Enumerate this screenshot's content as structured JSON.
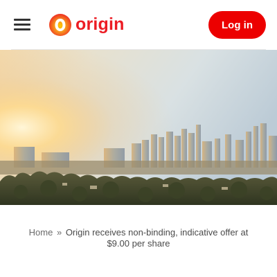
{
  "header": {
    "logo_text": "origin",
    "login_label": "Log in",
    "brand_color": "#ec1c24",
    "menu_icon": "hamburger-menu-icon"
  },
  "hero": {
    "description_icon": "city-skyline-sunrise-image"
  },
  "breadcrumb": {
    "home_label": "Home",
    "separator": "»",
    "current": "Origin receives non-binding, indicative offer at $9.00 per share"
  }
}
